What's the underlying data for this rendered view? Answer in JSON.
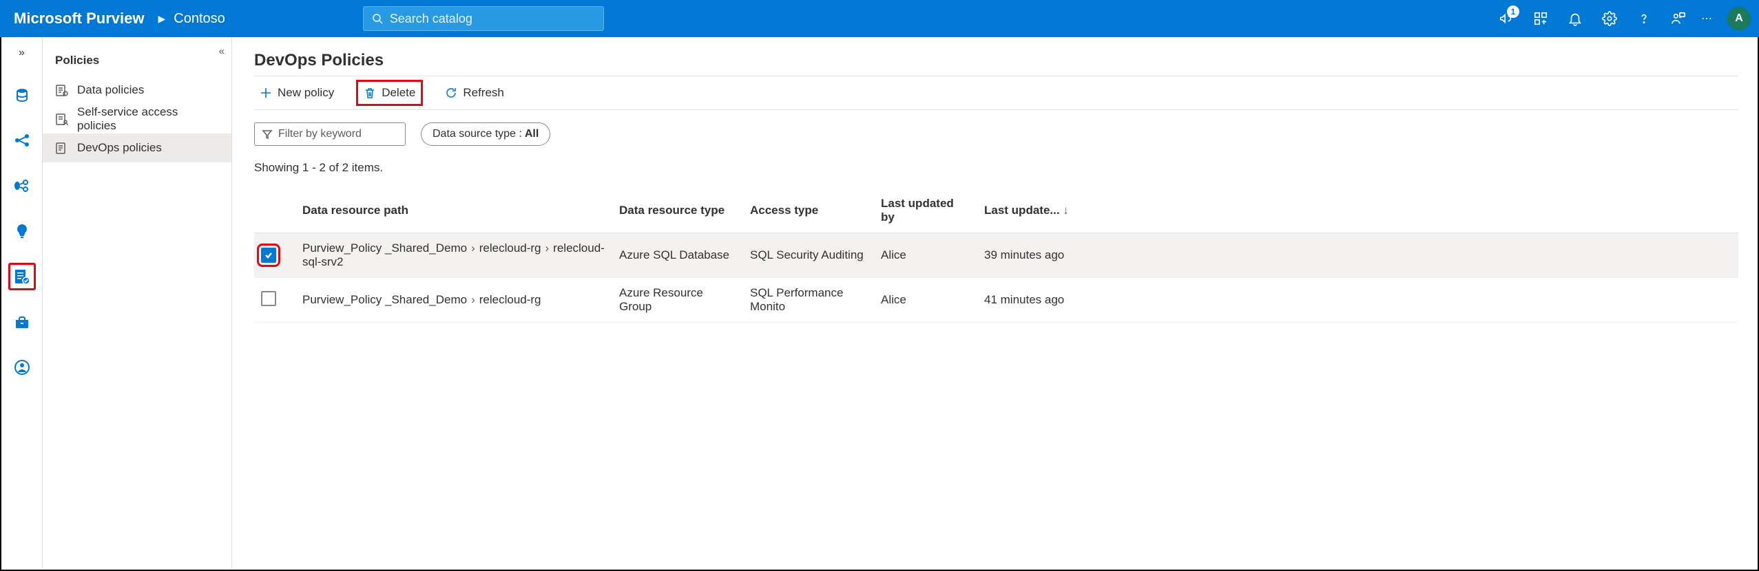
{
  "header": {
    "brand": "Microsoft Purview",
    "crumb": "Contoso",
    "search_placeholder": "Search catalog",
    "notification_badge": "1",
    "avatar_initial": "A"
  },
  "rail": {
    "items": [
      {
        "name": "data-sources-icon"
      },
      {
        "name": "data-map-icon"
      },
      {
        "name": "pipeline-icon"
      },
      {
        "name": "insights-icon"
      },
      {
        "name": "policy-icon",
        "highlighted": true
      },
      {
        "name": "management-icon"
      },
      {
        "name": "user-icon"
      }
    ]
  },
  "subnav": {
    "title": "Policies",
    "items": [
      {
        "label": "Data policies",
        "icon": "data-policies-icon"
      },
      {
        "label": "Self-service access policies",
        "icon": "self-service-icon"
      },
      {
        "label": "DevOps policies",
        "icon": "devops-policies-icon",
        "active": true
      }
    ]
  },
  "main": {
    "title": "DevOps Policies",
    "toolbar": {
      "new_label": "New policy",
      "delete_label": "Delete",
      "refresh_label": "Refresh"
    },
    "filter": {
      "keyword_placeholder": "Filter by keyword",
      "pill_label": "Data source type : ",
      "pill_value": "All"
    },
    "count_line": "Showing 1 - 2 of 2 items.",
    "columns": {
      "path": "Data resource path",
      "type": "Data resource type",
      "access": "Access type",
      "updated_by": "Last updated by",
      "updated_at": "Last update..."
    },
    "rows": [
      {
        "checked": true,
        "highlighted": true,
        "path": [
          "Purview_Policy _Shared_Demo",
          "relecloud-rg",
          "relecloud-sql-srv2"
        ],
        "type": "Azure SQL Database",
        "access": "SQL Security Auditing",
        "updated_by": "Alice",
        "updated_at": "39 minutes ago"
      },
      {
        "checked": false,
        "path": [
          "Purview_Policy _Shared_Demo",
          "relecloud-rg"
        ],
        "type": "Azure Resource Group",
        "access": "SQL Performance Monito",
        "updated_by": "Alice",
        "updated_at": "41 minutes ago"
      }
    ]
  }
}
